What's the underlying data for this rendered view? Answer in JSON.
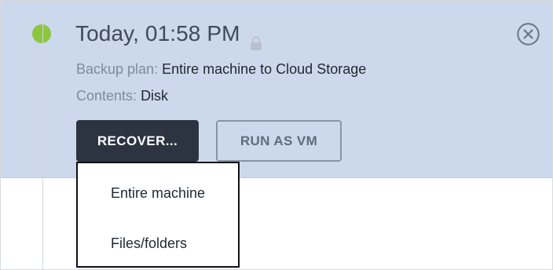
{
  "backup": {
    "title": "Today, 01:58 PM",
    "plan_label": "Backup plan:",
    "plan_value": "Entire machine to Cloud Storage",
    "contents_label": "Contents:",
    "contents_value": "Disk",
    "status_color": "#8cc63f"
  },
  "actions": {
    "recover_label": "RECOVER...",
    "run_vm_label": "RUN AS VM"
  },
  "recover_menu": {
    "items": [
      {
        "label": "Entire machine"
      },
      {
        "label": "Files/folders"
      }
    ]
  },
  "icons": {
    "lock": "lock-icon",
    "close": "close-circle-icon"
  }
}
